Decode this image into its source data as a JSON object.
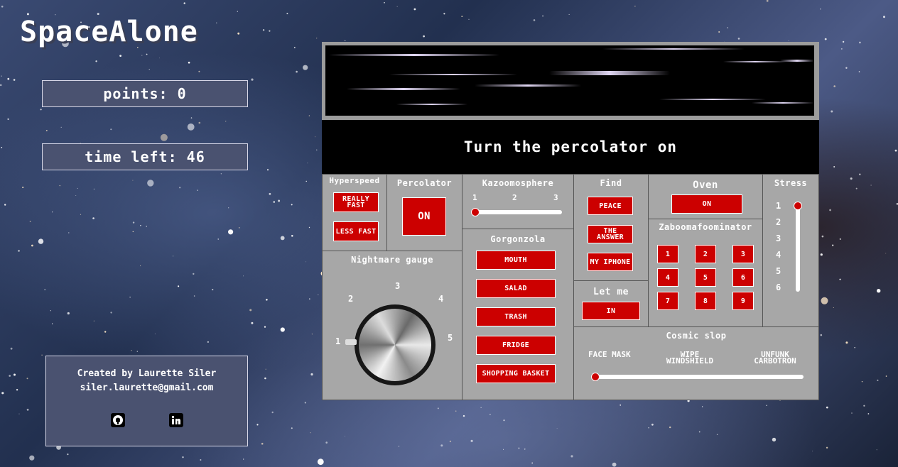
{
  "app": {
    "title": "SpaceAlone"
  },
  "stats": {
    "points": "points: 0",
    "time_left": "time left: 46"
  },
  "credits": {
    "created_by": "Created by Laurette Siler",
    "email": "siler.laurette@gmail.com",
    "icons": [
      "github-icon",
      "linkedin-icon"
    ]
  },
  "instruction": "Turn the percolator on",
  "panels": {
    "hyperspeed": {
      "label": "Hyperspeed",
      "buttons": [
        "REALLY FAST",
        "LESS FAST"
      ]
    },
    "percolator": {
      "label": "Percolator",
      "button": "ON"
    },
    "kazoomosphere": {
      "label": "Kazoomosphere",
      "ticks": [
        "1",
        "2",
        "3"
      ],
      "value": "1"
    },
    "gorgonzola": {
      "label": "Gorgonzola",
      "buttons": [
        "MOUTH",
        "SALAD",
        "TRASH",
        "FRIDGE",
        "SHOPPING BASKET"
      ]
    },
    "nightmare": {
      "label": "Nightmare gauge",
      "ticks": [
        "1",
        "2",
        "3",
        "4",
        "5"
      ],
      "value": "1"
    },
    "find": {
      "label": "Find",
      "buttons": [
        "PEACE",
        "THE ANSWER",
        "MY IPHONE"
      ]
    },
    "letme": {
      "label": "Let me",
      "button": "IN"
    },
    "oven": {
      "label": "Oven",
      "button": "ON"
    },
    "zaboomafoominator": {
      "label": "Zaboomafoominator",
      "buttons": [
        "1",
        "2",
        "3",
        "4",
        "5",
        "6",
        "7",
        "8",
        "9"
      ]
    },
    "stress": {
      "label": "Stress",
      "ticks": [
        "1",
        "2",
        "3",
        "4",
        "5",
        "6"
      ],
      "value": "1"
    },
    "cosmic": {
      "label": "Cosmic slop",
      "options": [
        "FACE MASK",
        "WIPE WINDSHIELD",
        "UNFUNK CARBOTRON"
      ],
      "value": "FACE MASK"
    }
  },
  "colors": {
    "accent": "#cc0000",
    "panel": "#a7a7a7",
    "stat_box": "#4a5270"
  }
}
